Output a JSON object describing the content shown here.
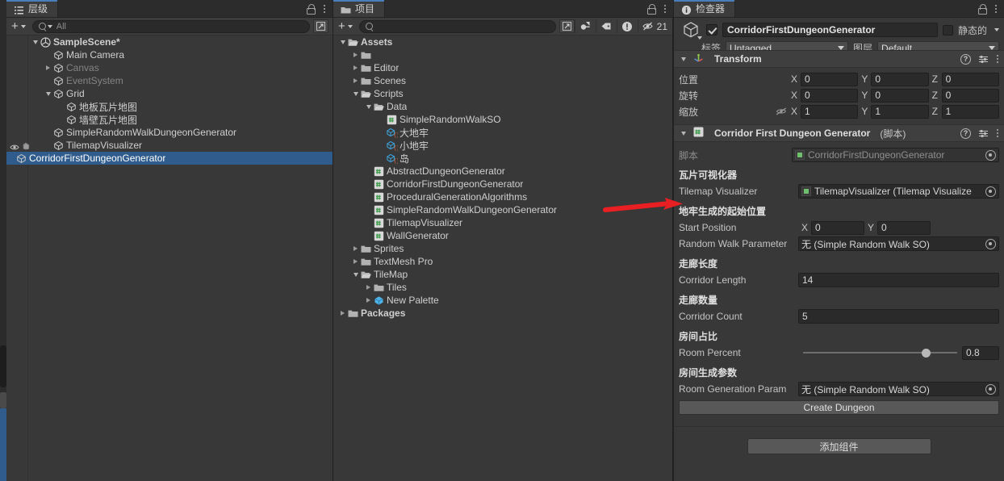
{
  "hierarchy": {
    "tab_label": "层级",
    "tab_icon": "hierarchy-icon",
    "toolbar": {
      "add_label": "+",
      "search_placeholder": "All",
      "search_value": ""
    },
    "items": [
      {
        "label": "SampleScene*",
        "depth": 0,
        "twisty": "down",
        "icon": "scene-icon",
        "bold": true,
        "dim": false,
        "selected": false
      },
      {
        "label": "Main Camera",
        "depth": 1,
        "twisty": "none",
        "icon": "gameobject-icon",
        "bold": false,
        "dim": false,
        "selected": false
      },
      {
        "label": "Canvas",
        "depth": 1,
        "twisty": "right",
        "icon": "gameobject-icon",
        "bold": false,
        "dim": true,
        "selected": false
      },
      {
        "label": "EventSystem",
        "depth": 1,
        "twisty": "none",
        "icon": "gameobject-icon",
        "bold": false,
        "dim": true,
        "selected": false
      },
      {
        "label": "Grid",
        "depth": 1,
        "twisty": "down",
        "icon": "gameobject-icon",
        "bold": false,
        "dim": false,
        "selected": false
      },
      {
        "label": "地板瓦片地图",
        "depth": 2,
        "twisty": "none",
        "icon": "gameobject-icon",
        "bold": false,
        "dim": false,
        "selected": false
      },
      {
        "label": "墙壁瓦片地图",
        "depth": 2,
        "twisty": "none",
        "icon": "gameobject-icon",
        "bold": false,
        "dim": false,
        "selected": false
      },
      {
        "label": "SimpleRandomWalkDungeonGenerator",
        "depth": 1,
        "twisty": "none",
        "icon": "gameobject-icon",
        "bold": false,
        "dim": false,
        "selected": false
      },
      {
        "label": "TilemapVisualizer",
        "depth": 1,
        "twisty": "none",
        "icon": "gameobject-icon",
        "bold": false,
        "dim": false,
        "selected": false
      },
      {
        "label": "CorridorFirstDungeonGenerator",
        "depth": 1,
        "twisty": "none",
        "icon": "gameobject-icon",
        "bold": false,
        "dim": false,
        "selected": true
      }
    ],
    "visibility_row_index": 8
  },
  "project": {
    "tab_label": "项目",
    "tab_icon": "folder-icon",
    "toolbar": {
      "add_label": "+",
      "search_placeholder": "",
      "search_value": "",
      "icons": [
        "save-search-icon",
        "filter-type-icon",
        "filter-label-icon",
        "warning-icon",
        "hidden-count-icon"
      ],
      "hidden_count": "21"
    },
    "items": [
      {
        "label": "Assets",
        "depth": 0,
        "twisty": "down",
        "icon": "folder-open-icon",
        "bold": true
      },
      {
        "label": "",
        "depth": 1,
        "twisty": "right",
        "icon": "folder-icon",
        "bold": false
      },
      {
        "label": "Editor",
        "depth": 1,
        "twisty": "right",
        "icon": "folder-icon",
        "bold": false
      },
      {
        "label": "Scenes",
        "depth": 1,
        "twisty": "right",
        "icon": "folder-icon",
        "bold": false
      },
      {
        "label": "Scripts",
        "depth": 1,
        "twisty": "down",
        "icon": "folder-open-icon",
        "bold": false
      },
      {
        "label": "Data",
        "depth": 2,
        "twisty": "down",
        "icon": "folder-open-icon",
        "bold": false
      },
      {
        "label": "SimpleRandomWalkSO",
        "depth": 3,
        "twisty": "none",
        "icon": "cs-script-icon",
        "bold": false
      },
      {
        "label": "大地牢",
        "depth": 3,
        "twisty": "none",
        "icon": "scriptable-object-icon",
        "bold": false
      },
      {
        "label": "小地牢",
        "depth": 3,
        "twisty": "none",
        "icon": "scriptable-object-icon",
        "bold": false
      },
      {
        "label": "岛",
        "depth": 3,
        "twisty": "none",
        "icon": "scriptable-object-icon",
        "bold": false
      },
      {
        "label": "AbstractDungeonGenerator",
        "depth": 2,
        "twisty": "none",
        "icon": "cs-script-icon",
        "bold": false
      },
      {
        "label": "CorridorFirstDungeonGenerator",
        "depth": 2,
        "twisty": "none",
        "icon": "cs-script-icon",
        "bold": false
      },
      {
        "label": "ProceduralGenerationAlgorithms",
        "depth": 2,
        "twisty": "none",
        "icon": "cs-script-icon",
        "bold": false
      },
      {
        "label": "SimpleRandomWalkDungeonGenerator",
        "depth": 2,
        "twisty": "none",
        "icon": "cs-script-icon",
        "bold": false
      },
      {
        "label": "TilemapVisualizer",
        "depth": 2,
        "twisty": "none",
        "icon": "cs-script-icon",
        "bold": false
      },
      {
        "label": "WallGenerator",
        "depth": 2,
        "twisty": "none",
        "icon": "cs-script-icon",
        "bold": false
      },
      {
        "label": "Sprites",
        "depth": 1,
        "twisty": "right",
        "icon": "folder-icon",
        "bold": false
      },
      {
        "label": "TextMesh Pro",
        "depth": 1,
        "twisty": "right",
        "icon": "folder-icon",
        "bold": false
      },
      {
        "label": "TileMap",
        "depth": 1,
        "twisty": "down",
        "icon": "folder-open-icon",
        "bold": false
      },
      {
        "label": "Tiles",
        "depth": 2,
        "twisty": "right",
        "icon": "folder-icon",
        "bold": false
      },
      {
        "label": "New Palette",
        "depth": 2,
        "twisty": "right",
        "icon": "prefab-icon",
        "bold": false
      },
      {
        "label": "Packages",
        "depth": 0,
        "twisty": "right",
        "icon": "folder-icon",
        "bold": true
      }
    ]
  },
  "inspector": {
    "tab_label": "检查器",
    "tab_icon": "info-icon",
    "gameobject": {
      "enabled": true,
      "name": "CorridorFirstDungeonGenerator",
      "static_label": "静态的",
      "tag_label": "标签",
      "tag_value": "Untagged",
      "layer_label": "图层",
      "layer_value": "Default"
    },
    "transform": {
      "title": "Transform",
      "rows": [
        {
          "label": "位置",
          "x": "0",
          "y": "0",
          "z": "0"
        },
        {
          "label": "旋转",
          "x": "0",
          "y": "0",
          "z": "0"
        },
        {
          "label": "缩放",
          "x": "1",
          "y": "1",
          "z": "1"
        }
      ],
      "axis_x": "X",
      "axis_y": "Y",
      "axis_z": "Z"
    },
    "script_component": {
      "title": "Corridor First Dungeon Generator",
      "title_suffix": "(脚本)",
      "script_label": "脚本",
      "script_value": "CorridorFirstDungeonGenerator",
      "groups": [
        {
          "header": "瓦片可视化器",
          "label": "Tilemap Visualizer",
          "value": "TilemapVisualizer (Tilemap Visualize",
          "kind": "object"
        },
        {
          "header": "地牢生成的起始位置",
          "label": "Start Position",
          "x": "0",
          "y": "0",
          "kind": "vector2"
        },
        {
          "header": "",
          "label": "Random Walk Parameter",
          "value": "无 (Simple Random Walk SO)",
          "kind": "object"
        },
        {
          "header": "走廊长度",
          "label": "Corridor Length",
          "value": "14",
          "kind": "number"
        },
        {
          "header": "走廊数量",
          "label": "Corridor Count",
          "value": "5",
          "kind": "number"
        },
        {
          "header": "房间占比",
          "label": "Room Percent",
          "value": "0.8",
          "kind": "slider",
          "slider_fraction": 0.8
        },
        {
          "header": "房间生成参数",
          "label": "Room Generation Param",
          "value": "无 (Simple Random Walk SO)",
          "kind": "object"
        }
      ],
      "create_button": "Create Dungeon"
    },
    "add_component_label": "添加组件"
  },
  "annotation": {
    "arrow_color": "#e81f23",
    "points_at": "Tilemap Visualizer"
  }
}
